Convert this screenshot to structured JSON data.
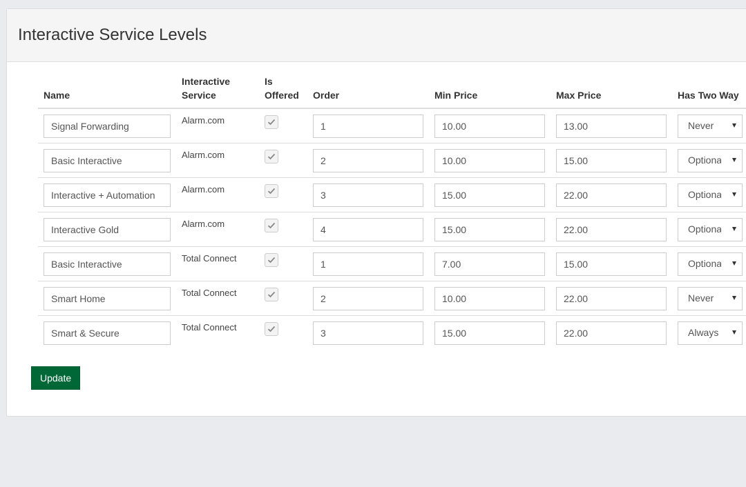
{
  "page": {
    "title": "Interactive Service Levels"
  },
  "table": {
    "headers": {
      "name": "Name",
      "service": "Interactive Service",
      "offered": "Is Offered",
      "order": "Order",
      "min_price": "Min Price",
      "max_price": "Max Price",
      "two_way": "Has Two Way"
    },
    "rows": [
      {
        "name": "Signal Forwarding",
        "service": "Alarm.com",
        "offered": true,
        "order": "1",
        "min_price": "10.00",
        "max_price": "13.00",
        "two_way": "Never"
      },
      {
        "name": "Basic Interactive",
        "service": "Alarm.com",
        "offered": true,
        "order": "2",
        "min_price": "10.00",
        "max_price": "15.00",
        "two_way": "Optional"
      },
      {
        "name": "Interactive + Automation",
        "service": "Alarm.com",
        "offered": true,
        "order": "3",
        "min_price": "15.00",
        "max_price": "22.00",
        "two_way": "Optional"
      },
      {
        "name": "Interactive Gold",
        "service": "Alarm.com",
        "offered": true,
        "order": "4",
        "min_price": "15.00",
        "max_price": "22.00",
        "two_way": "Optional"
      },
      {
        "name": "Basic Interactive",
        "service": "Total Connect",
        "offered": true,
        "order": "1",
        "min_price": "7.00",
        "max_price": "15.00",
        "two_way": "Optional"
      },
      {
        "name": "Smart Home",
        "service": "Total Connect",
        "offered": true,
        "order": "2",
        "min_price": "10.00",
        "max_price": "22.00",
        "two_way": "Never"
      },
      {
        "name": "Smart & Secure",
        "service": "Total Connect",
        "offered": true,
        "order": "3",
        "min_price": "15.00",
        "max_price": "22.00",
        "two_way": "Always"
      }
    ]
  },
  "actions": {
    "update_label": "Update"
  },
  "colors": {
    "primary_button": "#006837",
    "page_bg": "#e9ebee",
    "panel_heading_bg": "#f5f5f5"
  },
  "icons": {
    "checkbox": "checkmark-icon",
    "select": "caret-down-icon"
  }
}
